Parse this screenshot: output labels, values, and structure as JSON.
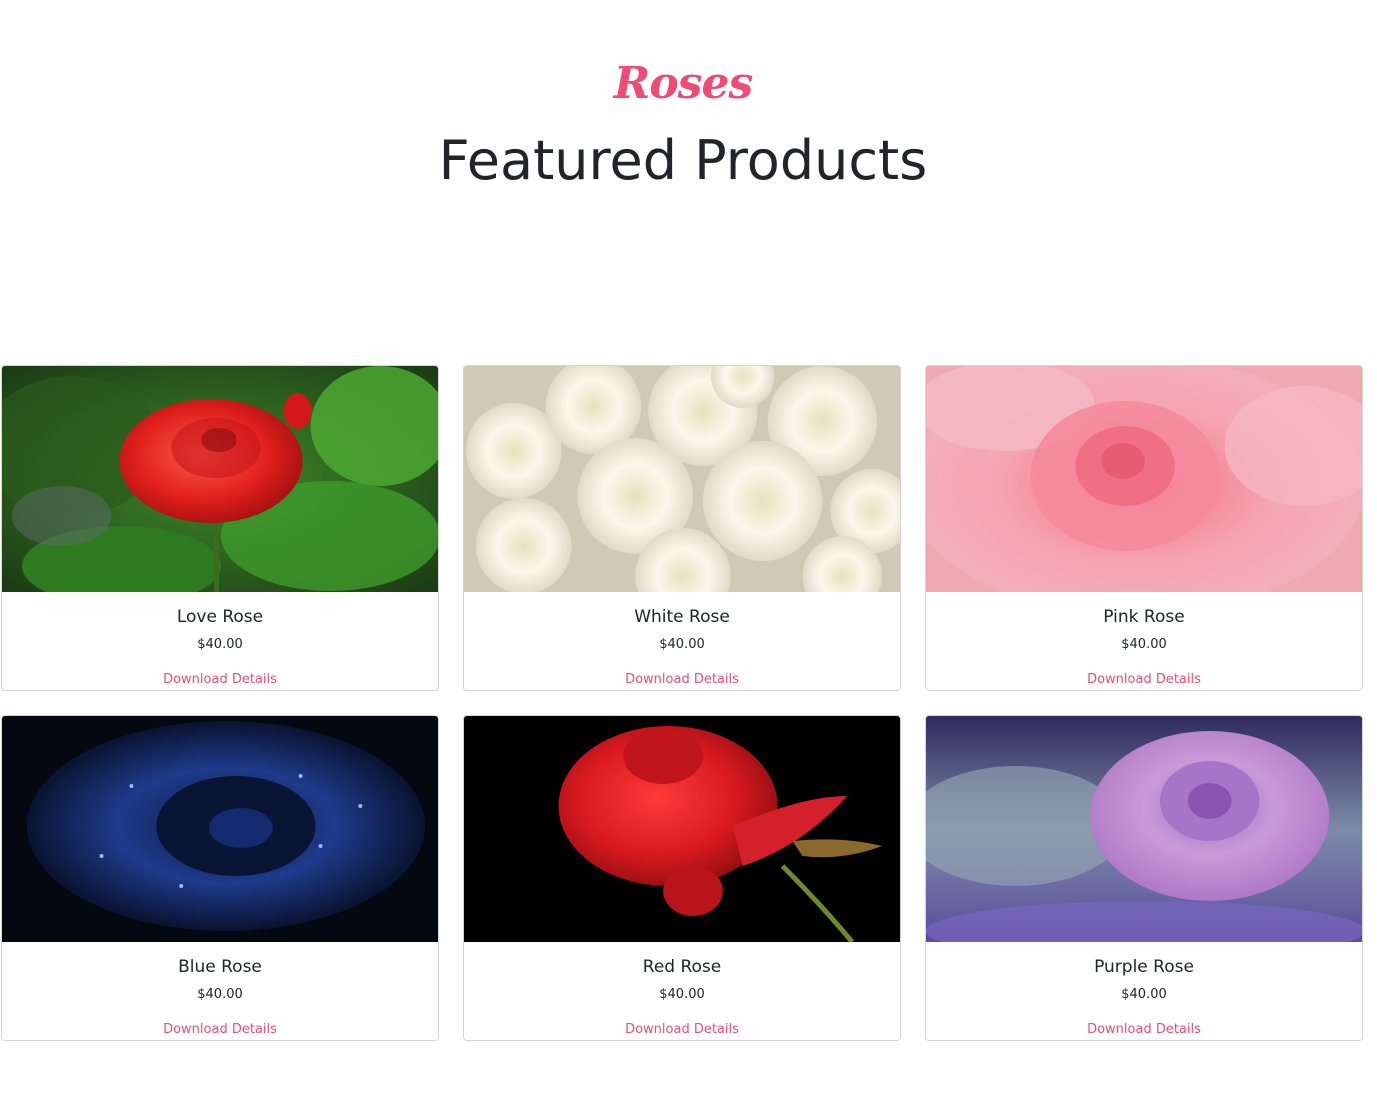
{
  "header": {
    "brand": "Roses",
    "title": "Featured Products"
  },
  "products": [
    {
      "name": "Love Rose",
      "price": "$40.00",
      "link": "Download Details",
      "image": "red-rose-garden-photo"
    },
    {
      "name": "White Rose",
      "price": "$40.00",
      "link": "Download Details",
      "image": "white-roses-bouquet-photo"
    },
    {
      "name": "Pink Rose",
      "price": "$40.00",
      "link": "Download Details",
      "image": "pink-rose-closeup-photo"
    },
    {
      "name": "Blue Rose",
      "price": "$40.00",
      "link": "Download Details",
      "image": "blue-rose-dark-photo"
    },
    {
      "name": "Red Rose",
      "price": "$40.00",
      "link": "Download Details",
      "image": "red-rose-black-bg-photo"
    },
    {
      "name": "Purple Rose",
      "price": "$40.00",
      "link": "Download Details",
      "image": "purple-rose-photo"
    }
  ],
  "colors": {
    "accent": "#ef4b74",
    "text": "#212529",
    "border": "#d5d5d5"
  }
}
